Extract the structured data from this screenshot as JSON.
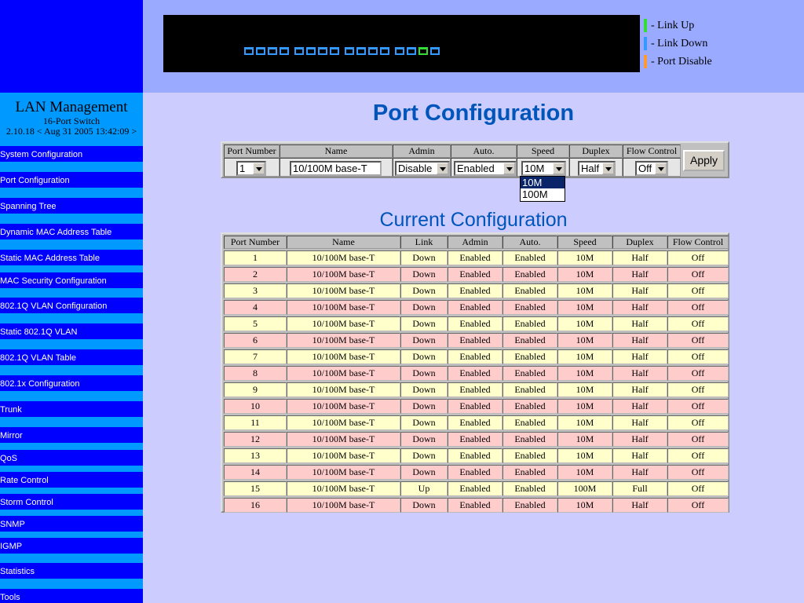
{
  "sidebar": {
    "title": "LAN Management",
    "subtitle": "16-Port Switch",
    "version": "2.10.18 < Aug 31 2005 13:42:09 >",
    "items": [
      {
        "label": "System Configuration"
      },
      {
        "label": "Port Configuration"
      },
      {
        "label": "Spanning Tree"
      },
      {
        "label": "Dynamic MAC Address Table"
      },
      {
        "label": "Static MAC Address Table"
      },
      {
        "label": "MAC Security Configuration"
      },
      {
        "label": "802.1Q VLAN Configuration"
      },
      {
        "label": "Static 802.1Q VLAN"
      },
      {
        "label": "802.1Q VLAN Table"
      },
      {
        "label": "802.1x Configuration"
      },
      {
        "label": "Trunk"
      },
      {
        "label": "Mirror"
      },
      {
        "label": "QoS"
      },
      {
        "label": "Rate Control"
      },
      {
        "label": "Storm Control"
      },
      {
        "label": "SNMP"
      },
      {
        "label": "IGMP"
      },
      {
        "label": "Statistics"
      },
      {
        "label": "Tools"
      }
    ]
  },
  "port_panel": {
    "ports": [
      "down",
      "down",
      "down",
      "down",
      "down",
      "down",
      "down",
      "down",
      "down",
      "down",
      "down",
      "down",
      "down",
      "down",
      "up",
      "down"
    ]
  },
  "legend": {
    "items": [
      {
        "label": "- Link Up",
        "color": "#33dd33"
      },
      {
        "label": "- Link Down",
        "color": "#3399ff"
      },
      {
        "label": "- Port Disable",
        "color": "#ff9933"
      }
    ]
  },
  "page": {
    "title": "Port Configuration",
    "current_title": "Current Configuration"
  },
  "form": {
    "headers": {
      "port_number": "Port Number",
      "name": "Name",
      "admin": "Admin",
      "auto": "Auto.",
      "speed": "Speed",
      "duplex": "Duplex",
      "flow_control": "Flow Control"
    },
    "port_number": "1",
    "name_value": "10/100M base-T",
    "admin": "Disable",
    "auto": "Enabled",
    "speed": "10M",
    "duplex": "Half",
    "flow_control": "Off",
    "apply_label": "Apply",
    "speed_options": [
      "10M",
      "100M"
    ]
  },
  "table": {
    "headers": [
      "Port Number",
      "Name",
      "Link",
      "Admin",
      "Auto.",
      "Speed",
      "Duplex",
      "Flow Control"
    ],
    "rows": [
      [
        "1",
        "10/100M base-T",
        "Down",
        "Enabled",
        "Enabled",
        "10M",
        "Half",
        "Off"
      ],
      [
        "2",
        "10/100M base-T",
        "Down",
        "Enabled",
        "Enabled",
        "10M",
        "Half",
        "Off"
      ],
      [
        "3",
        "10/100M base-T",
        "Down",
        "Enabled",
        "Enabled",
        "10M",
        "Half",
        "Off"
      ],
      [
        "4",
        "10/100M base-T",
        "Down",
        "Enabled",
        "Enabled",
        "10M",
        "Half",
        "Off"
      ],
      [
        "5",
        "10/100M base-T",
        "Down",
        "Enabled",
        "Enabled",
        "10M",
        "Half",
        "Off"
      ],
      [
        "6",
        "10/100M base-T",
        "Down",
        "Enabled",
        "Enabled",
        "10M",
        "Half",
        "Off"
      ],
      [
        "7",
        "10/100M base-T",
        "Down",
        "Enabled",
        "Enabled",
        "10M",
        "Half",
        "Off"
      ],
      [
        "8",
        "10/100M base-T",
        "Down",
        "Enabled",
        "Enabled",
        "10M",
        "Half",
        "Off"
      ],
      [
        "9",
        "10/100M base-T",
        "Down",
        "Enabled",
        "Enabled",
        "10M",
        "Half",
        "Off"
      ],
      [
        "10",
        "10/100M base-T",
        "Down",
        "Enabled",
        "Enabled",
        "10M",
        "Half",
        "Off"
      ],
      [
        "11",
        "10/100M base-T",
        "Down",
        "Enabled",
        "Enabled",
        "10M",
        "Half",
        "Off"
      ],
      [
        "12",
        "10/100M base-T",
        "Down",
        "Enabled",
        "Enabled",
        "10M",
        "Half",
        "Off"
      ],
      [
        "13",
        "10/100M base-T",
        "Down",
        "Enabled",
        "Enabled",
        "10M",
        "Half",
        "Off"
      ],
      [
        "14",
        "10/100M base-T",
        "Down",
        "Enabled",
        "Enabled",
        "10M",
        "Half",
        "Off"
      ],
      [
        "15",
        "10/100M base-T",
        "Up",
        "Enabled",
        "Enabled",
        "100M",
        "Full",
        "Off"
      ],
      [
        "16",
        "10/100M base-T",
        "Down",
        "Enabled",
        "Enabled",
        "10M",
        "Half",
        "Off"
      ]
    ]
  }
}
